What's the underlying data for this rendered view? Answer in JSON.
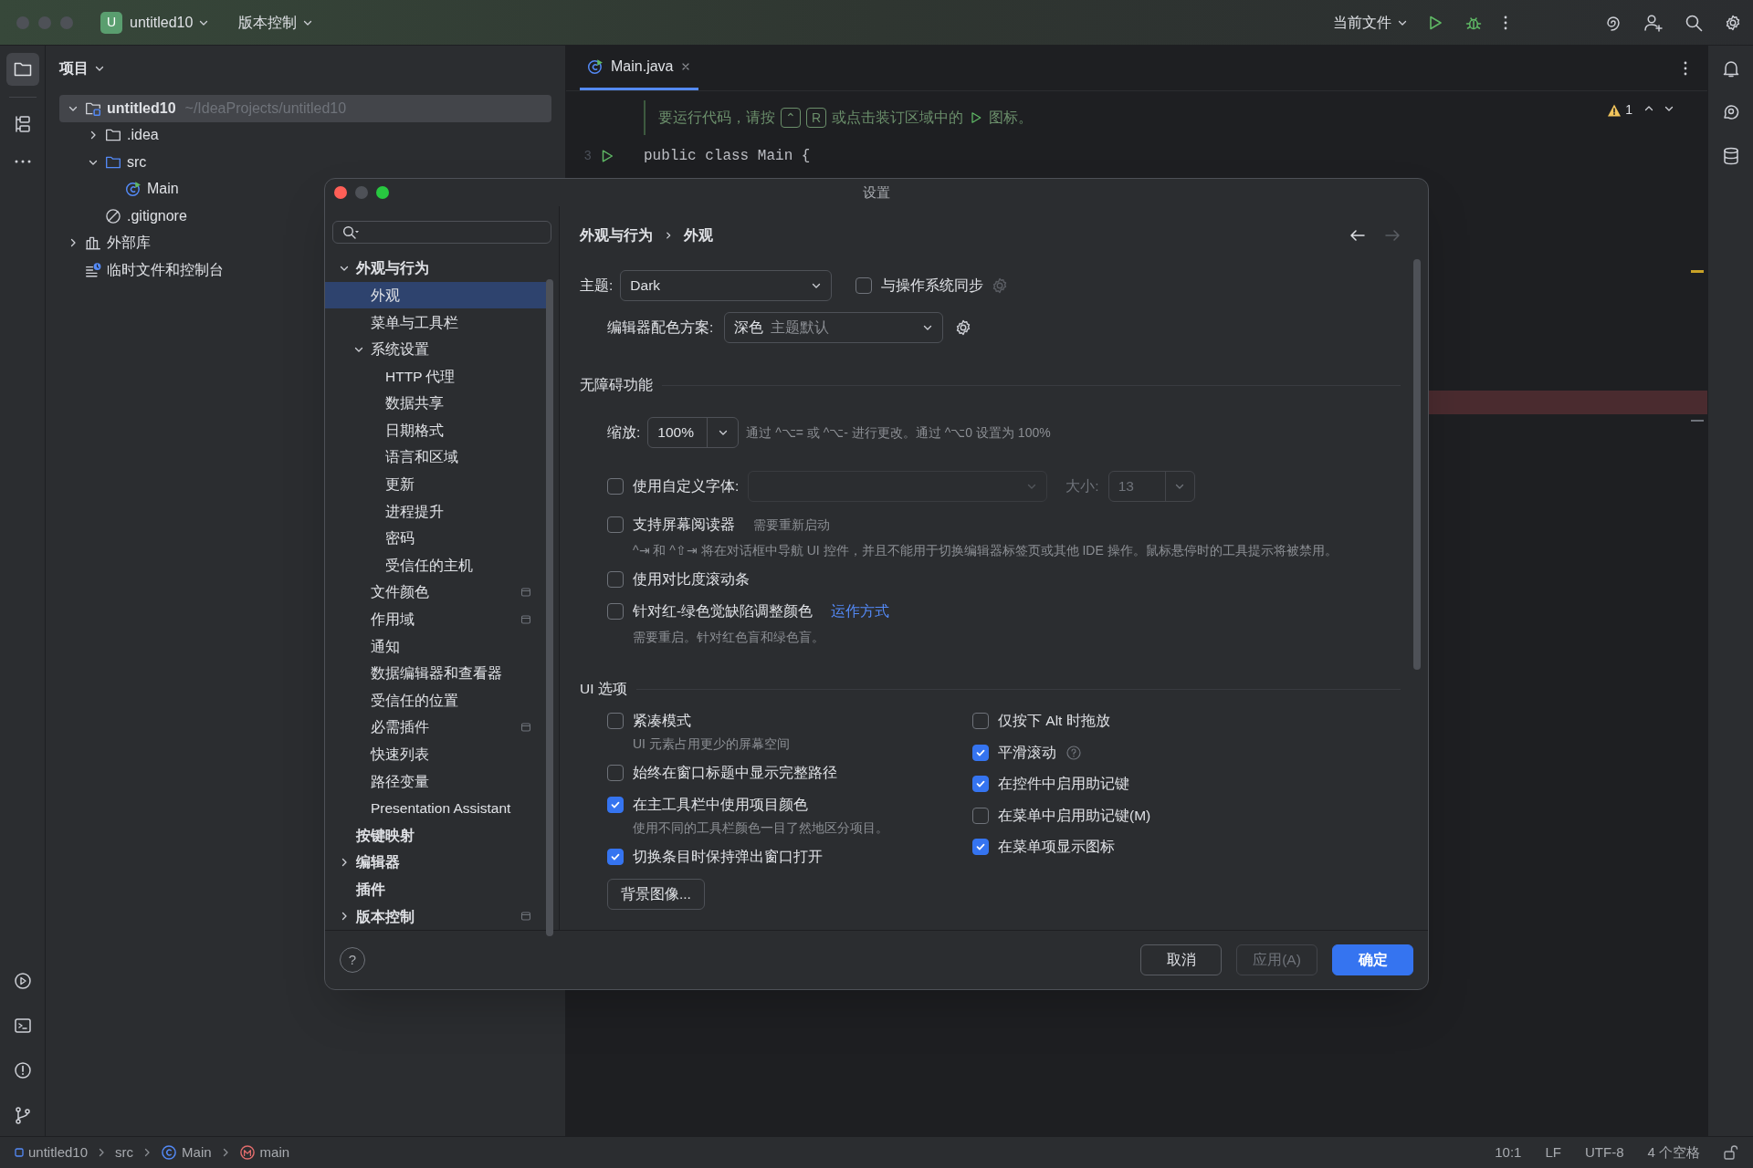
{
  "title_bar": {
    "project_badge": "U",
    "project": "untitled10",
    "vcs": "版本控制",
    "run_config": "当前文件"
  },
  "project_panel": {
    "title": "项目",
    "tree": [
      {
        "label": "untitled10",
        "path": "~/IdeaProjects/untitled10",
        "kind": "module",
        "expanded": true,
        "selected": true,
        "children": [
          {
            "label": ".idea",
            "kind": "folder",
            "expanded": false,
            "selected": false
          },
          {
            "label": "src",
            "kind": "source",
            "expanded": true,
            "selected": false,
            "children": [
              {
                "label": "Main",
                "kind": "class",
                "selected": false
              }
            ]
          },
          {
            "label": ".gitignore",
            "kind": "ignore",
            "selected": false
          }
        ]
      },
      {
        "label": "外部库",
        "kind": "library",
        "expanded": false,
        "selected": false
      },
      {
        "label": "临时文件和控制台",
        "kind": "scratch",
        "selected": false
      }
    ]
  },
  "editor": {
    "tabs": [
      {
        "label": "Main.java",
        "selected": true
      }
    ],
    "hint": [
      {
        "kind": "text",
        "text": "要运行代码，请按"
      },
      {
        "kind": "key",
        "text": "⌃"
      },
      {
        "kind": "key",
        "text": "R"
      },
      {
        "kind": "text",
        "text": "或点击装订区域中的"
      },
      {
        "kind": "run_icon"
      },
      {
        "kind": "text",
        "text": "图标。"
      }
    ],
    "lines": [
      {
        "number": "3",
        "text": "public class Main {",
        "runnable": true
      }
    ],
    "warnings": "1"
  },
  "dialog": {
    "title": "设置",
    "help": "?",
    "nav": [
      {
        "label": "外观与行为",
        "expanded": true,
        "selected": false,
        "scoped": false,
        "children": [
          {
            "label": "外观",
            "selected": true,
            "scoped": false
          },
          {
            "label": "菜单与工具栏",
            "selected": false,
            "scoped": false
          },
          {
            "label": "系统设置",
            "expanded": true,
            "selected": false,
            "scoped": false,
            "children": [
              {
                "label": "HTTP 代理",
                "selected": false,
                "scoped": false
              },
              {
                "label": "数据共享",
                "selected": false,
                "scoped": false
              },
              {
                "label": "日期格式",
                "selected": false,
                "scoped": false
              },
              {
                "label": "语言和区域",
                "selected": false,
                "scoped": false
              },
              {
                "label": "更新",
                "selected": false,
                "scoped": false
              },
              {
                "label": "进程提升",
                "selected": false,
                "scoped": false
              },
              {
                "label": "密码",
                "selected": false,
                "scoped": false
              },
              {
                "label": "受信任的主机",
                "selected": false,
                "scoped": false
              }
            ]
          },
          {
            "label": "文件颜色",
            "selected": false,
            "scoped": true
          },
          {
            "label": "作用域",
            "selected": false,
            "scoped": true
          },
          {
            "label": "通知",
            "selected": false,
            "scoped": false
          },
          {
            "label": "数据编辑器和查看器",
            "selected": false,
            "scoped": false
          },
          {
            "label": "受信任的位置",
            "selected": false,
            "scoped": false
          },
          {
            "label": "必需插件",
            "selected": false,
            "scoped": true
          },
          {
            "label": "快速列表",
            "selected": false,
            "scoped": false
          },
          {
            "label": "路径变量",
            "selected": false,
            "scoped": false
          },
          {
            "label": "Presentation Assistant",
            "selected": false,
            "scoped": false
          }
        ]
      },
      {
        "label": "按键映射",
        "selected": false,
        "scoped": false
      },
      {
        "label": "编辑器",
        "expanded": false,
        "selected": false,
        "scoped": false
      },
      {
        "label": "插件",
        "selected": false,
        "scoped": false
      },
      {
        "label": "版本控制",
        "expanded": false,
        "selected": false,
        "scoped": true
      }
    ],
    "breadcrumb": [
      "外观与行为",
      "外观"
    ],
    "theme": {
      "label": "主题:",
      "value": "Dark",
      "sync": {
        "label": "与操作系统同步",
        "checked": false
      }
    },
    "scheme": {
      "label": "编辑器配色方案:",
      "value": "深色",
      "hint": "主题默认"
    },
    "accessibility": {
      "title": "无障碍功能",
      "zoom": {
        "label": "缩放:",
        "value": "100%",
        "hint": "通过 ^⌥= 或 ^⌥- 进行更改。通过 ^⌥0 设置为 100%"
      },
      "font": {
        "label": "使用自定义字体:",
        "checked": false,
        "size_label": "大小:",
        "size": "13"
      },
      "options": [
        {
          "label": "支持屏幕阅读器",
          "checked": false,
          "note": "需要重新启动",
          "description": "^⇥ 和 ^⇧⇥ 将在对话框中导航 UI 控件，并且不能用于切换编辑器标签页或其他 IDE 操作。鼠标悬停时的工具提示将被禁用。"
        },
        {
          "label": "使用对比度滚动条",
          "checked": false
        },
        {
          "label": "针对红-绿色觉缺陷调整颜色",
          "checked": false,
          "link": "运作方式",
          "description": "需要重启。针对红色盲和绿色盲。"
        }
      ]
    },
    "ui_options": {
      "title": "UI 选项",
      "left": [
        {
          "label": "紧凑模式",
          "checked": false,
          "description": "UI 元素占用更少的屏幕空间"
        },
        {
          "label": "始终在窗口标题中显示完整路径",
          "checked": false
        },
        {
          "label": "在主工具栏中使用项目颜色",
          "checked": true,
          "description": "使用不同的工具栏颜色一目了然地区分项目。"
        },
        {
          "label": "切换条目时保持弹出窗口打开",
          "checked": true
        }
      ],
      "button": "背景图像...",
      "right": [
        {
          "label": "仅按下 Alt 时拖放",
          "checked": false,
          "help": false
        },
        {
          "label": "平滑滚动",
          "checked": true,
          "help": true
        },
        {
          "label": "在控件中启用助记键",
          "checked": true,
          "help": false
        },
        {
          "label": "在菜单中启用助记键(M)",
          "checked": false,
          "help": false
        },
        {
          "label": "在菜单项显示图标",
          "checked": true,
          "help": false
        }
      ]
    },
    "buttons": [
      {
        "label": "取消",
        "kind": "default"
      },
      {
        "label": "应用(A)",
        "kind": "disabled"
      },
      {
        "label": "确定",
        "kind": "primary"
      }
    ]
  },
  "status_bar": {
    "breadcrumbs": [
      {
        "label": "untitled10",
        "kind": "module"
      },
      {
        "label": "src",
        "kind": "folder"
      },
      {
        "label": "Main",
        "kind": "class"
      },
      {
        "label": "main",
        "kind": "method"
      }
    ],
    "items": [
      "10:1",
      "LF",
      "UTF-8",
      "4 个空格"
    ]
  }
}
